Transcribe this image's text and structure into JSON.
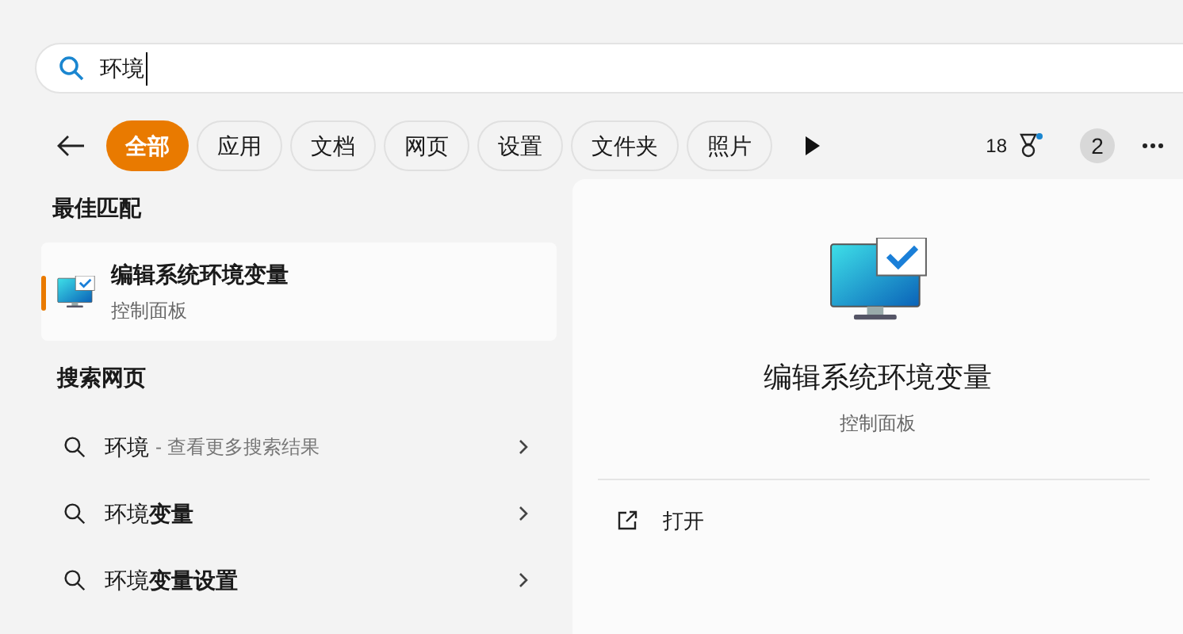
{
  "search": {
    "value": "环境"
  },
  "filters": [
    {
      "label": "全部",
      "selected": true
    },
    {
      "label": "应用",
      "selected": false
    },
    {
      "label": "文档",
      "selected": false
    },
    {
      "label": "网页",
      "selected": false
    },
    {
      "label": "设置",
      "selected": false
    },
    {
      "label": "文件夹",
      "selected": false
    },
    {
      "label": "照片",
      "selected": false
    }
  ],
  "points": "18",
  "notification_count": "2",
  "best_match": {
    "heading": "最佳匹配",
    "title": "编辑系统环境变量",
    "subtitle": "控制面板",
    "selected": true
  },
  "web": {
    "heading": "搜索网页",
    "items": [
      {
        "text": "环境",
        "suffix": "- 查看更多搜索结果"
      },
      {
        "text": "环境**变量**"
      },
      {
        "text": "环境**变量设置**"
      }
    ]
  },
  "detail": {
    "title": "编辑系统环境变量",
    "subtitle": "控制面板",
    "actions": [
      "打开"
    ]
  }
}
